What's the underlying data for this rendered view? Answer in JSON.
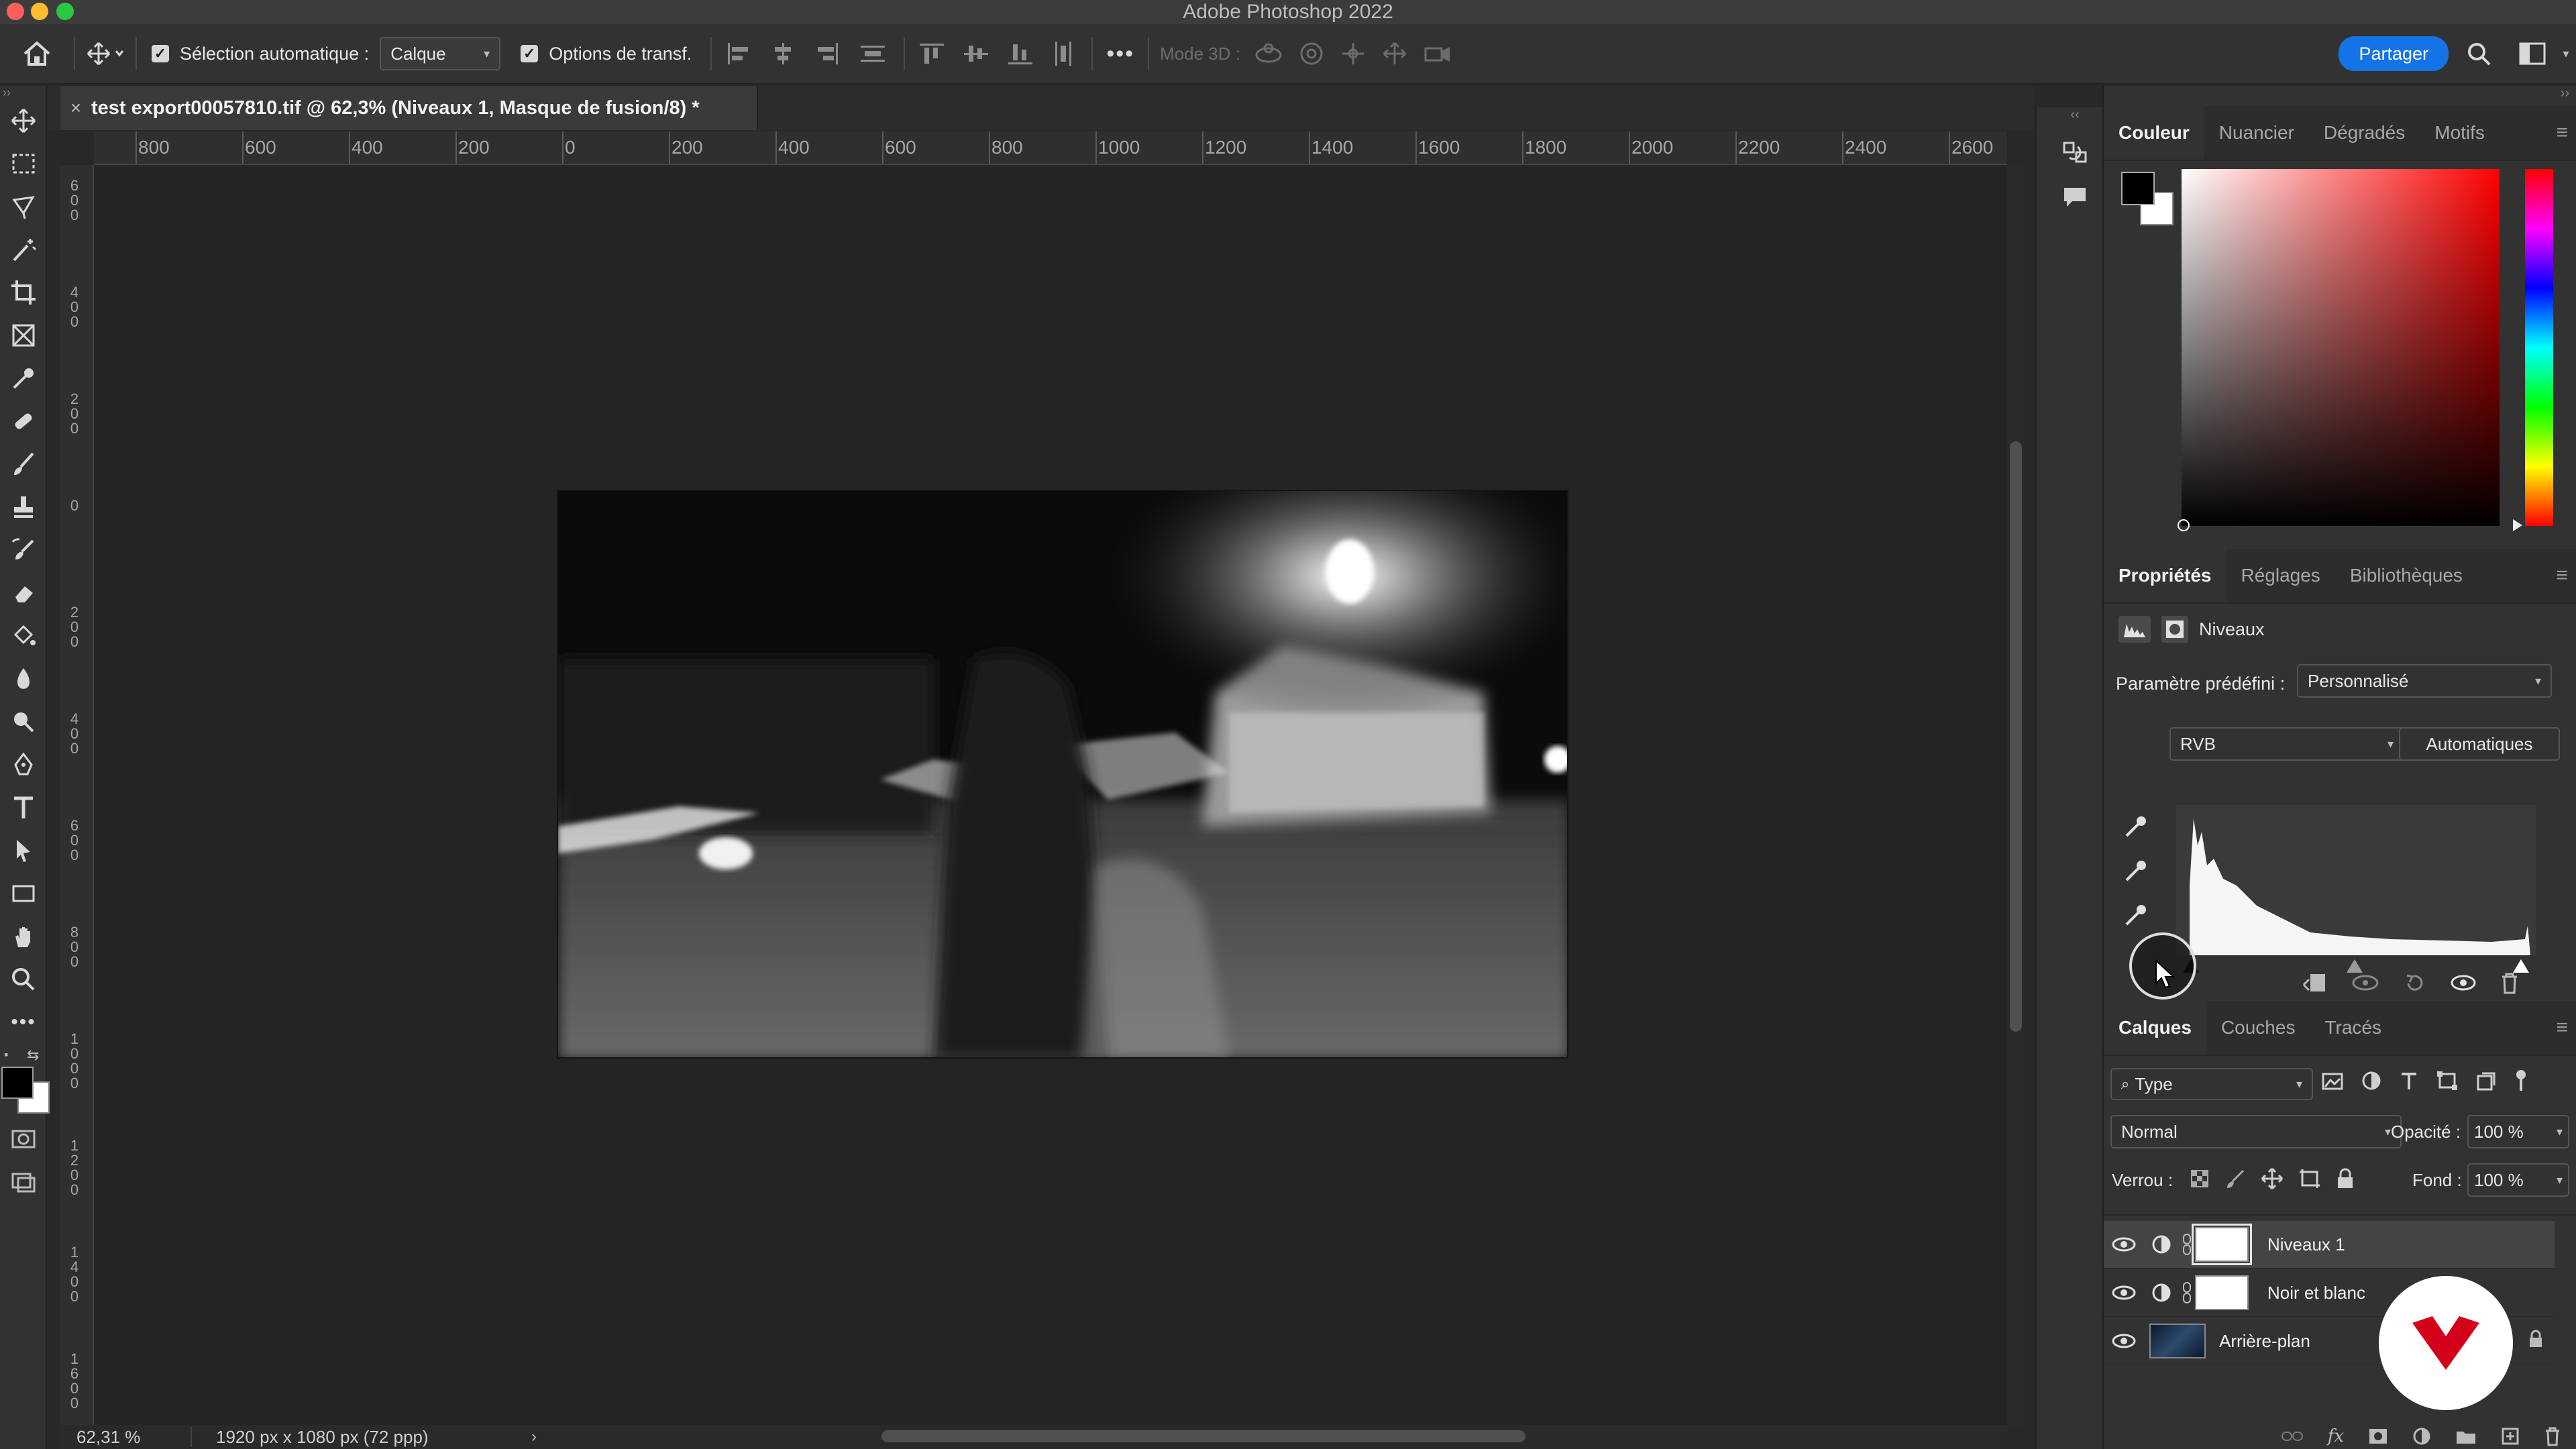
{
  "app": {
    "title": "Adobe Photoshop 2022",
    "share_label": "Partager"
  },
  "options": {
    "auto_select_label": "Sélection automatique :",
    "auto_select_value": "Calque",
    "transform_label": "Options de transf.",
    "mode3d_label": "Mode 3D :"
  },
  "document": {
    "tab_title": "test export00057810.tif @ 62,3% (Niveaux 1, Masque de fusion/8) *",
    "zoom": "62,31 %",
    "dimensions": "1920 px x 1080 px (72 ppp)"
  },
  "ruler": {
    "h": [
      "800",
      "600",
      "400",
      "200",
      "0",
      "200",
      "400",
      "600",
      "800",
      "1000",
      "1200",
      "1400",
      "1600",
      "1800",
      "2000",
      "2200",
      "2400",
      "2600"
    ],
    "v": [
      "600",
      "400",
      "200",
      "0",
      "200",
      "400",
      "600",
      "800",
      "1000",
      "1200",
      "1400",
      "1600"
    ]
  },
  "color_panel": {
    "tabs": [
      "Couleur",
      "Nuancier",
      "Dégradés",
      "Motifs"
    ]
  },
  "properties": {
    "tabs": [
      "Propriétés",
      "Réglages",
      "Bibliothèques"
    ],
    "adjustment_name": "Niveaux",
    "preset_label": "Paramètre prédéfini :",
    "preset_value": "Personnalisé",
    "channel_value": "RVB",
    "auto_button": "Automatiques"
  },
  "layers_panel": {
    "tabs": [
      "Calques",
      "Couches",
      "Tracés"
    ],
    "filter_value": "Type",
    "blend_mode": "Normal",
    "opacity_label": "Opacité :",
    "opacity_value": "100 %",
    "lock_label": "Verrou :",
    "fill_label": "Fond :",
    "fill_value": "100 %",
    "layers": [
      "Niveaux 1",
      "Noir et blanc",
      "Arrière-plan"
    ]
  }
}
